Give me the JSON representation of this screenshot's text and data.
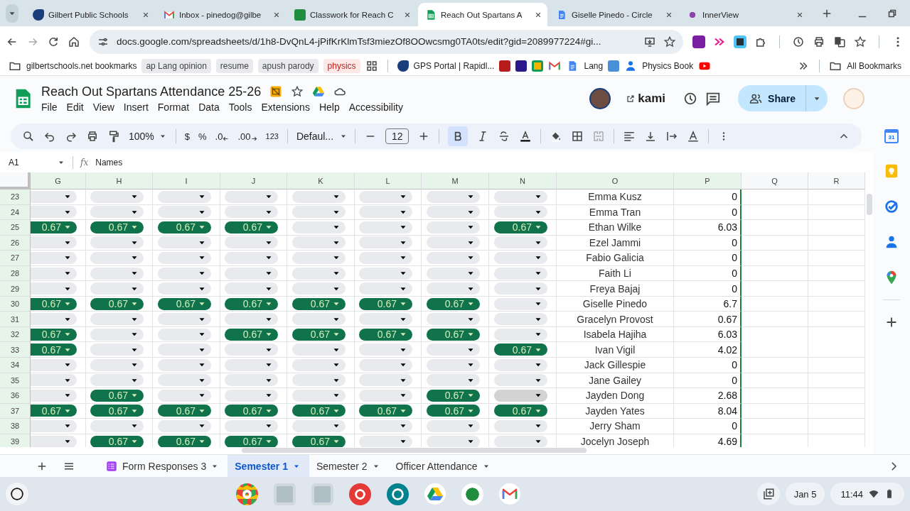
{
  "browser": {
    "tabs": [
      {
        "title": "Gilbert Public Schools",
        "selected": false
      },
      {
        "title": "Inbox - pinedog@gilbe",
        "selected": false
      },
      {
        "title": "Classwork for Reach C",
        "selected": false
      },
      {
        "title": "Reach Out Spartans A",
        "selected": true
      },
      {
        "title": "Giselle Pinedo - Circle",
        "selected": false
      },
      {
        "title": "InnerView",
        "selected": false
      }
    ],
    "address": "docs.google.com/spreadsheets/d/1h8-DvQnL4-jPifKrKlmTsf3miezOf8OOwcsmg0TA0ts/edit?gid=2089977224#gi...",
    "bookmarks": {
      "folder": "gilbertschools.net bookmarks",
      "chips": [
        {
          "label": "ap Lang opinion",
          "color": "#e8eaed"
        },
        {
          "label": "resume",
          "color": "#e8eaed"
        },
        {
          "label": "apush parody",
          "color": "#e8eaed"
        },
        {
          "label": "physics",
          "color": "#fce8e6"
        }
      ],
      "portal": "GPS Portal | Rapidl...",
      "lang": "Lang",
      "physics_book": "Physics Book",
      "all": "All Bookmarks"
    }
  },
  "sheet": {
    "title": "Reach Out Spartans Attendance 25-26",
    "menus": [
      "File",
      "Edit",
      "View",
      "Insert",
      "Format",
      "Data",
      "Tools",
      "Extensions",
      "Help",
      "Accessibility"
    ],
    "kami": "kami",
    "share": "Share",
    "toolbar": {
      "zoom": "100%",
      "currency": "$",
      "percent": "%",
      "dec_less": ".0",
      "dec_more": ".00",
      "number_format": "123",
      "font": "Defaul...",
      "font_size": "12",
      "bold": true
    },
    "name_box": "A1",
    "fx": "fx",
    "formula": "Names",
    "columns": [
      {
        "label": "G",
        "selected": true
      },
      {
        "label": "H",
        "selected": true
      },
      {
        "label": "I",
        "selected": true
      },
      {
        "label": "J",
        "selected": true
      },
      {
        "label": "K",
        "selected": true
      },
      {
        "label": "L",
        "selected": true
      },
      {
        "label": "M",
        "selected": true
      },
      {
        "label": "N",
        "selected": true
      },
      {
        "label": "O",
        "selected": true
      },
      {
        "label": "P",
        "selected": true
      },
      {
        "label": "Q",
        "selected": false
      },
      {
        "label": "R",
        "selected": false
      }
    ],
    "rows": [
      {
        "number": "23",
        "chips": [
          {
            "hovered": false
          },
          {
            "hovered": false
          },
          {
            "hovered": false
          },
          {
            "hovered": false
          },
          {
            "hovered": false
          },
          {
            "hovered": false
          },
          {
            "hovered": false
          },
          {
            "hovered": false
          }
        ],
        "name": "Emma Kusz",
        "total": "0"
      },
      {
        "number": "24",
        "chips": [
          {
            "hovered": false
          },
          {
            "hovered": false
          },
          {
            "hovered": false
          },
          {
            "hovered": false
          },
          {
            "hovered": false
          },
          {
            "hovered": false
          },
          {
            "hovered": false
          },
          {
            "hovered": false
          }
        ],
        "name": "Emma Tran",
        "total": "0"
      },
      {
        "number": "25",
        "chips": [
          {
            "value": "0.67",
            "hovered": false
          },
          {
            "value": "0.67",
            "hovered": false
          },
          {
            "value": "0.67",
            "hovered": false
          },
          {
            "value": "0.67",
            "hovered": false
          },
          {
            "hovered": false
          },
          {
            "hovered": false
          },
          {
            "hovered": false
          },
          {
            "value": "0.67",
            "hovered": false
          }
        ],
        "name": "Ethan Wilke",
        "total": "6.03"
      },
      {
        "number": "26",
        "chips": [
          {
            "hovered": false
          },
          {
            "hovered": false
          },
          {
            "hovered": false
          },
          {
            "hovered": false
          },
          {
            "hovered": false
          },
          {
            "hovered": false
          },
          {
            "hovered": false
          },
          {
            "hovered": false
          }
        ],
        "name": "Ezel Jammi",
        "total": "0"
      },
      {
        "number": "27",
        "chips": [
          {
            "hovered": false
          },
          {
            "hovered": false
          },
          {
            "hovered": false
          },
          {
            "hovered": false
          },
          {
            "hovered": false
          },
          {
            "hovered": false
          },
          {
            "hovered": false
          },
          {
            "hovered": false
          }
        ],
        "name": "Fabio Galicia",
        "total": "0"
      },
      {
        "number": "28",
        "chips": [
          {
            "hovered": false
          },
          {
            "hovered": false
          },
          {
            "hovered": false
          },
          {
            "hovered": false
          },
          {
            "hovered": false
          },
          {
            "hovered": false
          },
          {
            "hovered": false
          },
          {
            "hovered": false
          }
        ],
        "name": "Faith Li",
        "total": "0"
      },
      {
        "number": "29",
        "chips": [
          {
            "hovered": false
          },
          {
            "hovered": false
          },
          {
            "hovered": false
          },
          {
            "hovered": false
          },
          {
            "hovered": false
          },
          {
            "hovered": false
          },
          {
            "hovered": false
          },
          {
            "hovered": false
          }
        ],
        "name": "Freya Bajaj",
        "total": "0"
      },
      {
        "number": "30",
        "chips": [
          {
            "value": "0.67",
            "hovered": false
          },
          {
            "value": "0.67",
            "hovered": false
          },
          {
            "value": "0.67",
            "hovered": false
          },
          {
            "value": "0.67",
            "hovered": false
          },
          {
            "value": "0.67",
            "hovered": false
          },
          {
            "value": "0.67",
            "hovered": false
          },
          {
            "value": "0.67",
            "hovered": false
          },
          {
            "hovered": false
          }
        ],
        "name": "Giselle Pinedo",
        "total": "6.7"
      },
      {
        "number": "31",
        "chips": [
          {
            "hovered": false
          },
          {
            "hovered": false
          },
          {
            "hovered": false
          },
          {
            "hovered": false
          },
          {
            "hovered": false
          },
          {
            "hovered": false
          },
          {
            "hovered": false
          },
          {
            "hovered": false
          }
        ],
        "name": "Gracelyn Provost",
        "total": "0.67"
      },
      {
        "number": "32",
        "chips": [
          {
            "value": "0.67",
            "hovered": false
          },
          {
            "hovered": false
          },
          {
            "hovered": false
          },
          {
            "value": "0.67",
            "hovered": false
          },
          {
            "value": "0.67",
            "hovered": false
          },
          {
            "value": "0.67",
            "hovered": false
          },
          {
            "value": "0.67",
            "hovered": false
          },
          {
            "hovered": false
          }
        ],
        "name": "Isabela Hajiha",
        "total": "6.03"
      },
      {
        "number": "33",
        "chips": [
          {
            "value": "0.67",
            "hovered": false
          },
          {
            "hovered": false
          },
          {
            "hovered": false
          },
          {
            "hovered": false
          },
          {
            "hovered": false
          },
          {
            "hovered": false
          },
          {
            "hovered": false
          },
          {
            "value": "0.67",
            "hovered": false
          }
        ],
        "name": "Ivan Vigil",
        "total": "4.02"
      },
      {
        "number": "34",
        "chips": [
          {
            "hovered": false
          },
          {
            "hovered": false
          },
          {
            "hovered": false
          },
          {
            "hovered": false
          },
          {
            "hovered": false
          },
          {
            "hovered": false
          },
          {
            "hovered": false
          },
          {
            "hovered": false
          }
        ],
        "name": "Jack Gillespie",
        "total": "0"
      },
      {
        "number": "35",
        "chips": [
          {
            "hovered": false
          },
          {
            "hovered": false
          },
          {
            "hovered": false
          },
          {
            "hovered": false
          },
          {
            "hovered": false
          },
          {
            "hovered": false
          },
          {
            "hovered": false
          },
          {
            "hovered": false
          }
        ],
        "name": "Jane Gailey",
        "total": "0"
      },
      {
        "number": "36",
        "chips": [
          {
            "hovered": false
          },
          {
            "value": "0.67",
            "hovered": false
          },
          {
            "hovered": false
          },
          {
            "hovered": false
          },
          {
            "hovered": false
          },
          {
            "hovered": false
          },
          {
            "value": "0.67",
            "hovered": false
          },
          {
            "hovered": true
          }
        ],
        "name": "Jayden Dong",
        "total": "2.68"
      },
      {
        "number": "37",
        "chips": [
          {
            "value": "0.67",
            "hovered": false
          },
          {
            "value": "0.67",
            "hovered": false
          },
          {
            "value": "0.67",
            "hovered": false
          },
          {
            "value": "0.67",
            "hovered": false
          },
          {
            "value": "0.67",
            "hovered": false
          },
          {
            "value": "0.67",
            "hovered": false
          },
          {
            "value": "0.67",
            "hovered": false
          },
          {
            "value": "0.67",
            "hovered": false
          }
        ],
        "name": "Jayden Yates",
        "total": "8.04"
      },
      {
        "number": "38",
        "chips": [
          {
            "hovered": false
          },
          {
            "hovered": false
          },
          {
            "hovered": false
          },
          {
            "hovered": false
          },
          {
            "hovered": false
          },
          {
            "hovered": false
          },
          {
            "hovered": false
          },
          {
            "hovered": false
          }
        ],
        "name": "Jerry Sham",
        "total": "0"
      },
      {
        "number": "39",
        "chips": [
          {
            "hovered": false
          },
          {
            "value": "0.67",
            "hovered": false
          },
          {
            "value": "0.67",
            "hovered": false
          },
          {
            "value": "0.67",
            "hovered": false
          },
          {
            "value": "0.67",
            "hovered": false
          },
          {
            "hovered": false
          },
          {
            "hovered": false
          },
          {
            "hovered": false
          }
        ],
        "name": "Jocelyn Joseph",
        "total": "4.69"
      }
    ],
    "sheet_tabs": [
      {
        "label": "Form Responses 3",
        "kind": "form",
        "selected": false
      },
      {
        "label": "Semester 1",
        "kind": "sheet",
        "selected": true
      },
      {
        "label": "Semester 2",
        "kind": "sheet",
        "selected": false
      },
      {
        "label": "Officer Attendance",
        "kind": "sheet",
        "selected": false
      }
    ]
  },
  "side_panel": {
    "calendar_day": "31"
  },
  "taskbar": {
    "date": "Jan 5",
    "time": "11:44"
  }
}
